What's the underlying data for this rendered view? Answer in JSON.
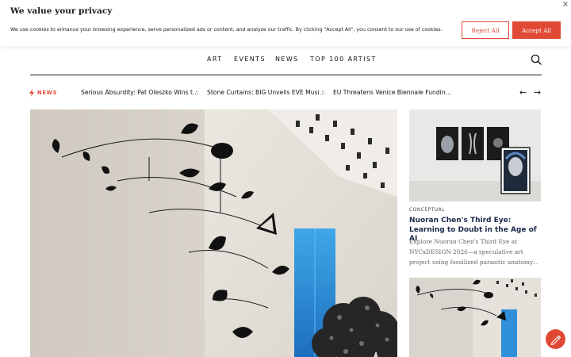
{
  "cookie": {
    "title": "We value your privacy",
    "text": "We use cookies to enhance your browsing experience, serve personalized ads or content, and analyze our traffic. By clicking \"Accept All\", you consent to our use of cookies.",
    "reject_label": "Reject All",
    "accept_label": "Accept All",
    "close_glyph": "×"
  },
  "nav": {
    "items": [
      "ART",
      "EVENTS",
      "NEWS",
      "TOP 100 ARTIST"
    ],
    "search_icon": "search-icon"
  },
  "ticker": {
    "label": "NEWS",
    "items": [
      "Serious Absurdity: Pat Oleszko Wins t…",
      "Stone Curtains: BIG Unveils EVE Musi…",
      "EU Threatens Venice Biennale Fundin…"
    ],
    "prev_glyph": "←",
    "next_glyph": "→"
  },
  "side_card": {
    "category": "CONCEPTUAL",
    "title": "Nuoran Chen's Third Eye: Learning to Doubt in the Age of AI",
    "description": "Explore Nuoran Chen's Third Eye at NYCxDESIGN 2026—a speculative art project using fossilized parasitic anatomy..."
  },
  "colors": {
    "accent": "#e04a35",
    "title_navy": "#1a2a4a"
  }
}
